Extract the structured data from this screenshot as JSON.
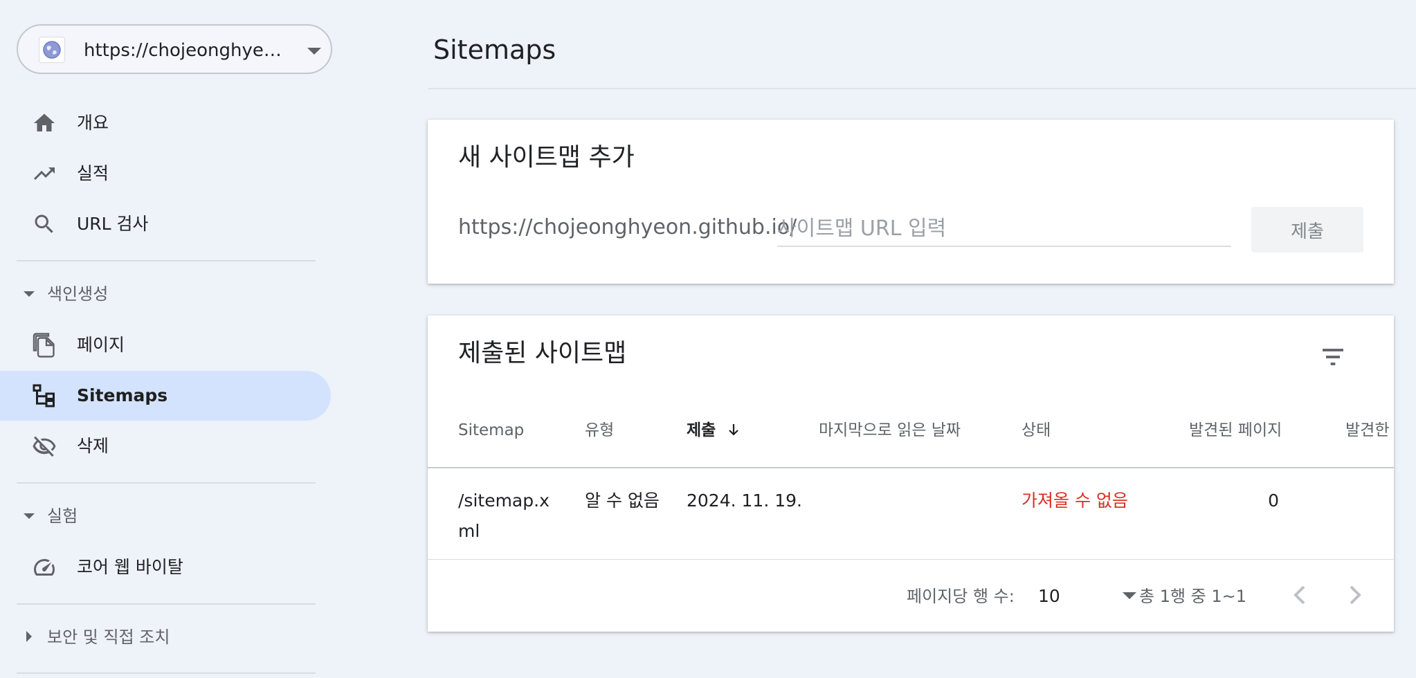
{
  "property": {
    "url": "https://chojeonghyeon.github.io/"
  },
  "sidebar": {
    "items": [
      {
        "label": "개요",
        "icon": "home-icon"
      },
      {
        "label": "실적",
        "icon": "trending-up-icon"
      },
      {
        "label": "URL 검사",
        "icon": "search-icon"
      }
    ],
    "indexing": {
      "section_label": "색인생성",
      "items": [
        {
          "label": "페이지",
          "icon": "pages-icon"
        },
        {
          "label": "Sitemaps",
          "icon": "sitemap-icon",
          "active": true
        },
        {
          "label": "삭제",
          "icon": "eye-off-icon"
        }
      ]
    },
    "experience": {
      "section_label": "실험",
      "items": [
        {
          "label": "코어 웹 바이탈",
          "icon": "speedometer-icon"
        }
      ]
    },
    "security": {
      "section_label": "보안 및 직접 조치"
    }
  },
  "main": {
    "title": "Sitemaps",
    "add_card": {
      "title": "새 사이트맵 추가",
      "url_prefix": "https://chojeonghyeon.github.io/",
      "input_placeholder": "사이트맵 URL 입력",
      "submit_label": "제출"
    },
    "submitted_card": {
      "title": "제출된 사이트맵",
      "columns": [
        "Sitemap",
        "유형",
        "제출",
        "마지막으로 읽은 날짜",
        "상태",
        "발견된 페이지",
        "발견한 동영상"
      ],
      "sorted_column": "제출",
      "rows": [
        {
          "sitemap": "/sitemap.xml",
          "type": "알 수 없음",
          "submitted": "2024. 11. 19.",
          "last_read": "",
          "status": "가져올 수 없음",
          "pages": "0",
          "videos": ""
        }
      ],
      "pagination": {
        "rows_per_page_label": "페이지당 행 수:",
        "rows_per_page": "10",
        "range": "총 1행 중 1~1"
      }
    }
  },
  "colors": {
    "accent_active": "#d3e3fd",
    "error": "#d93025",
    "background": "#eef2f9"
  }
}
